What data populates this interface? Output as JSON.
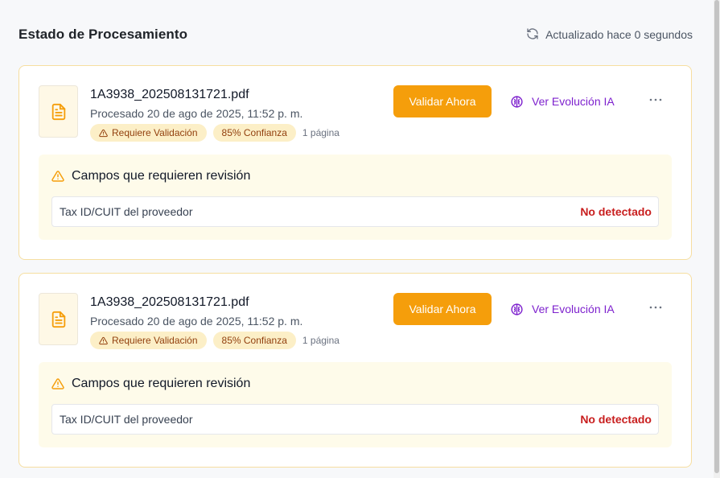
{
  "header": {
    "title": "Estado de Procesamiento",
    "status_text": "Actualizado hace 0 segundos"
  },
  "cards": [
    {
      "filename": "1A3938_202508131721.pdf",
      "processed": "Procesado 20 de ago de 2025, 11:52 p. m.",
      "badge_validation": "Requiere Validación",
      "badge_confidence": "85% Confianza",
      "pages": "1 página",
      "validate_label": "Validar Ahora",
      "evolution_label": "Ver Evolución IA",
      "review": {
        "title": "Campos que requieren revisión",
        "field": "Tax ID/CUIT del proveedor",
        "field_status": "No detectado"
      }
    },
    {
      "filename": "1A3938_202508131721.pdf",
      "processed": "Procesado 20 de ago de 2025, 11:52 p. m.",
      "badge_validation": "Requiere Validación",
      "badge_confidence": "85% Confianza",
      "pages": "1 página",
      "validate_label": "Validar Ahora",
      "evolution_label": "Ver Evolución IA",
      "review": {
        "title": "Campos que requieren revisión",
        "field": "Tax ID/CUIT del proveedor",
        "field_status": "No detectado"
      }
    }
  ],
  "colors": {
    "accent": "#f59e0b",
    "purple": "#7e22ce",
    "error": "#c81e1e",
    "badge_bg": "#fcefc7"
  },
  "icons": {
    "refresh": "refresh-icon",
    "document": "document-icon",
    "warning": "warning-icon",
    "brain": "brain-icon",
    "more": "more-icon"
  }
}
